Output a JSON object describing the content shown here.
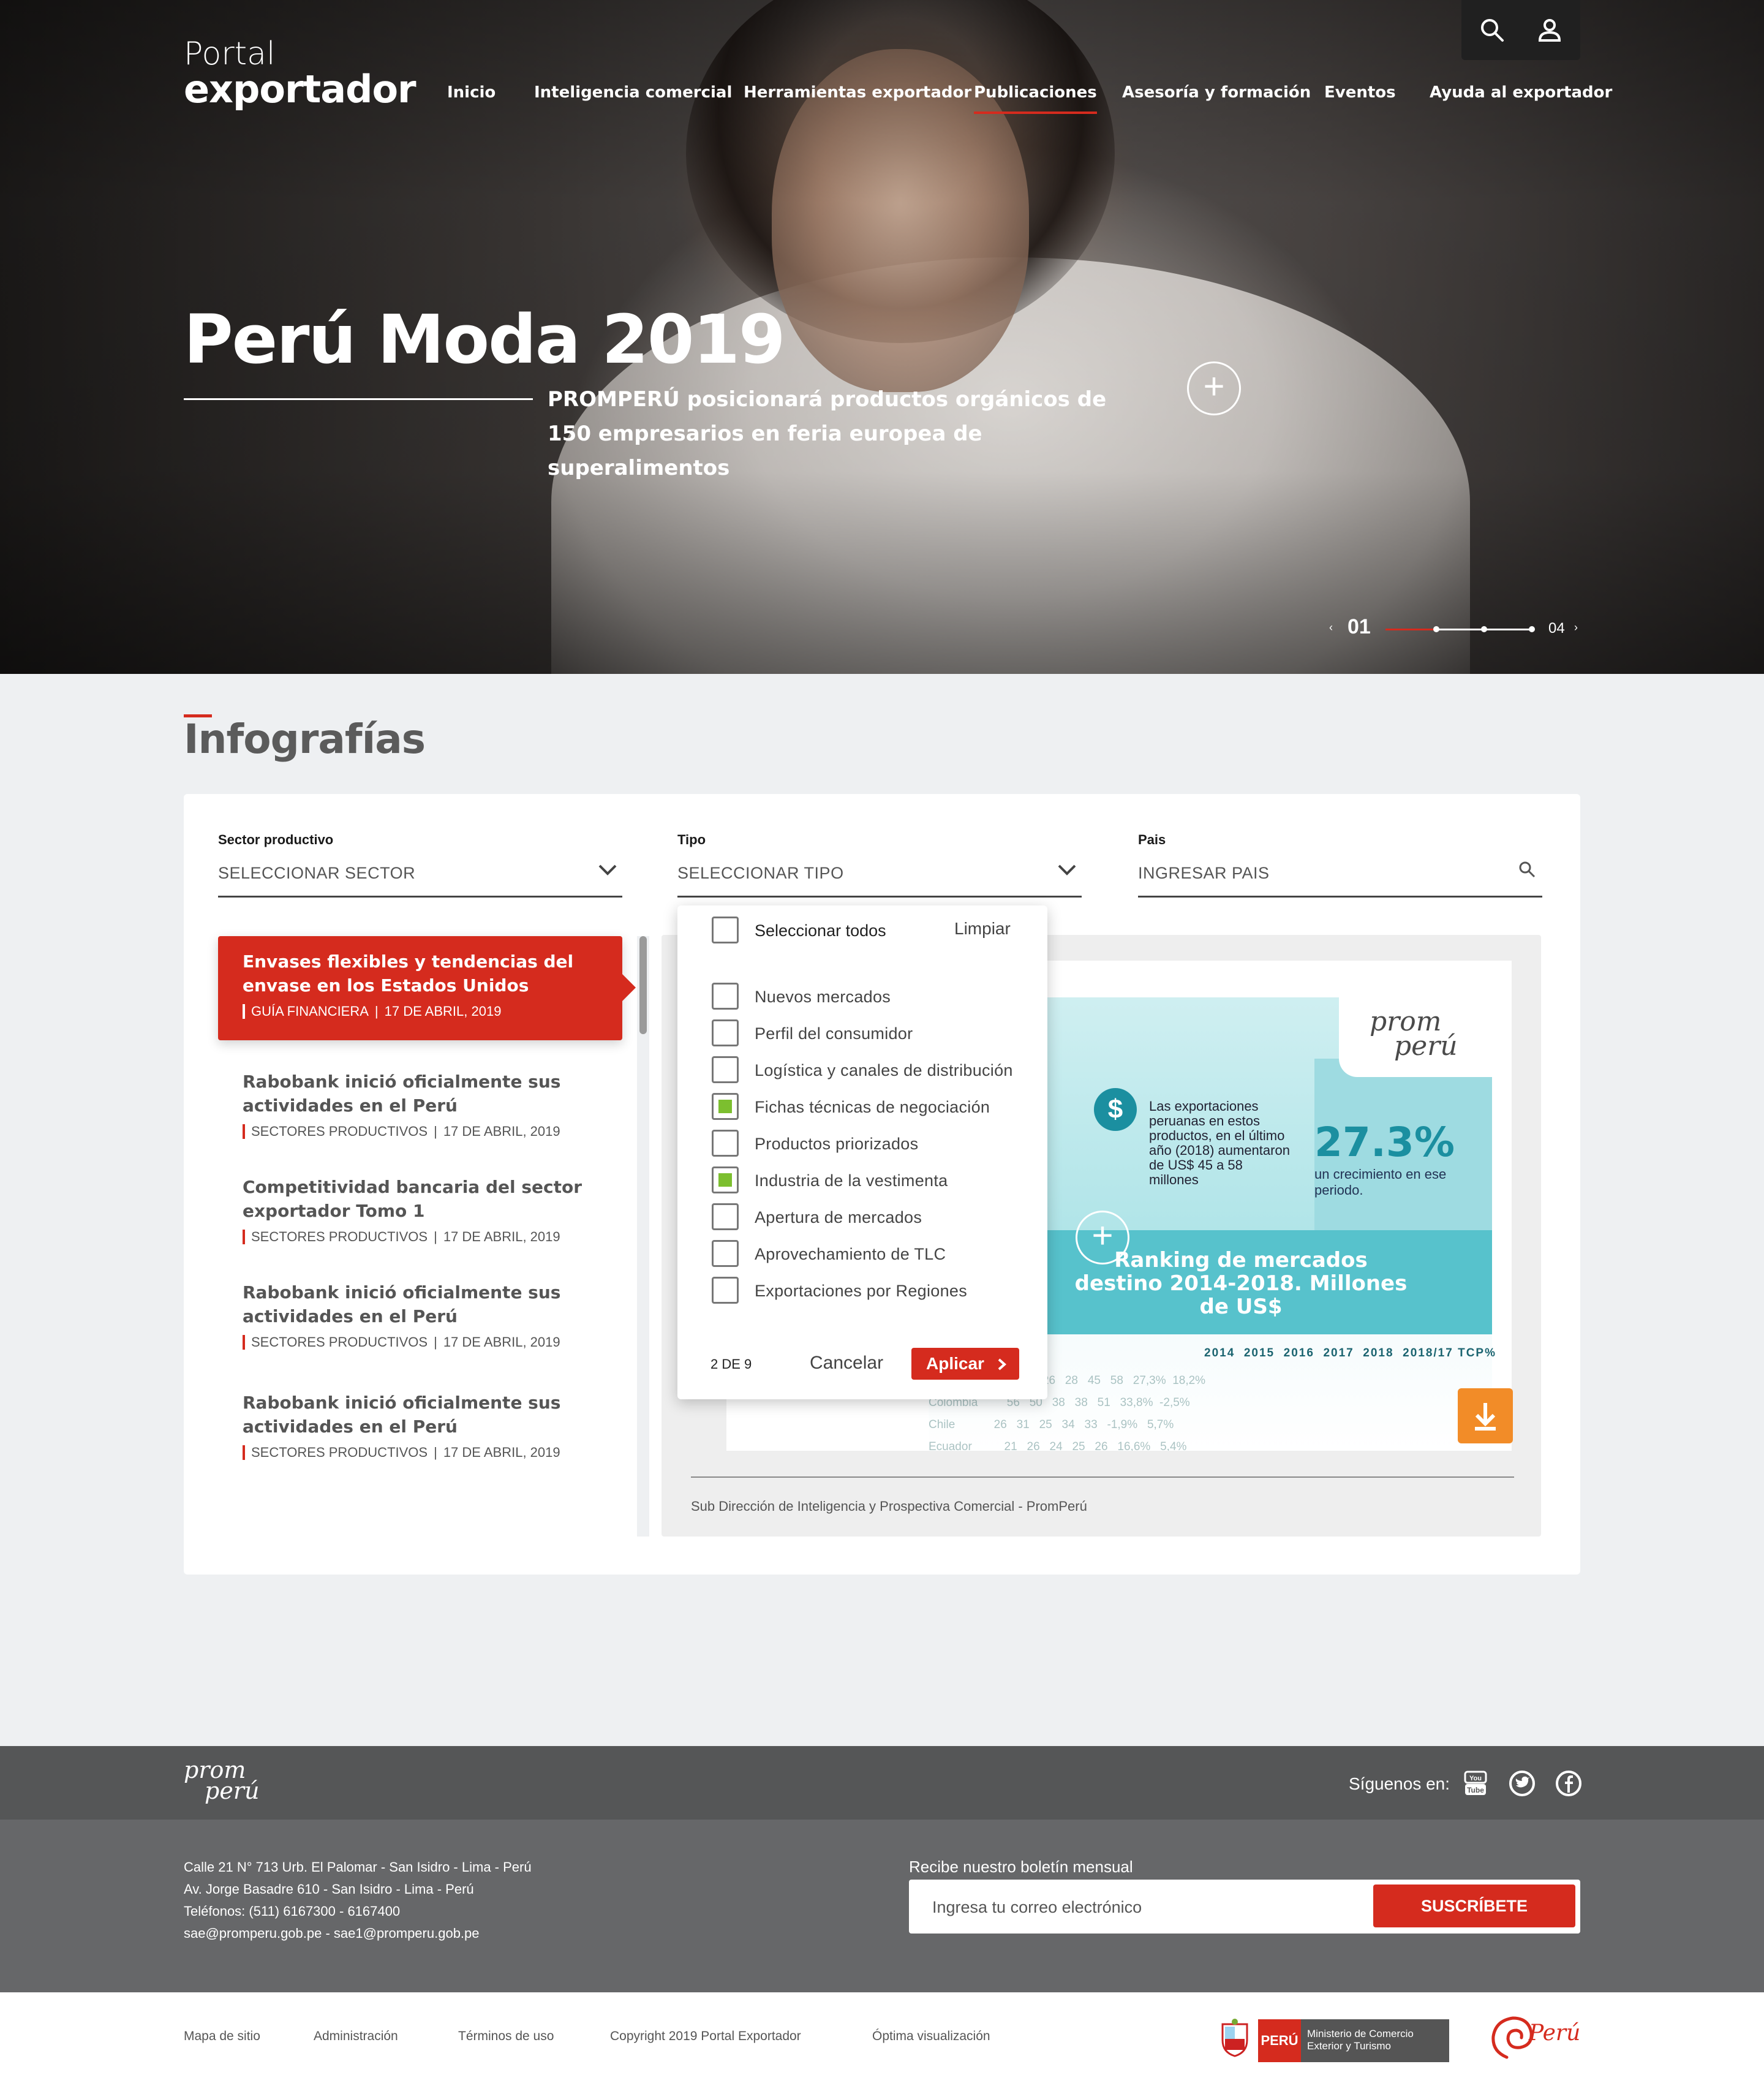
{
  "brand": {
    "line1": "Portal",
    "line2": "exportador"
  },
  "nav": [
    {
      "label": "Inicio",
      "active": false
    },
    {
      "label": "Inteligencia comercial",
      "active": false
    },
    {
      "label": "Herramientas exportador",
      "active": false
    },
    {
      "label": "Publicaciones",
      "active": true
    },
    {
      "label": "Asesoría y formación",
      "active": false
    },
    {
      "label": "Eventos",
      "active": false
    },
    {
      "label": "Ayuda al exportador",
      "active": false
    }
  ],
  "tools": {
    "search_icon": "search-icon",
    "user_icon": "user-icon"
  },
  "hero": {
    "title": "Perú Moda 2019",
    "subtitle": "PROMPERÚ posicionará productos orgánicos de 150 empresarios en feria europea de superalimentos",
    "plus": "+",
    "pager": {
      "current": "01",
      "total": "04",
      "prev": "‹",
      "next": "›",
      "progress": 0.33
    }
  },
  "section": {
    "title": "Infografías"
  },
  "filters": {
    "sector": {
      "label": "Sector productivo",
      "value": "SELECCIONAR SECTOR"
    },
    "tipo": {
      "label": "Tipo",
      "value": "SELECCIONAR TIPO"
    },
    "pais": {
      "label": "Pais",
      "placeholder": "INGRESAR PAIS"
    }
  },
  "list": [
    {
      "title": "Envases flexibles y tendencias del envase en los Estados Unidos",
      "category": "GUÍA FINANCIERA",
      "date": "17 DE ABRIL, 2019",
      "active": true
    },
    {
      "title": "Rabobank inició oficialmente sus actividades en el Perú",
      "category": "SECTORES PRODUCTIVOS",
      "date": "17 DE ABRIL, 2019",
      "active": false
    },
    {
      "title": "Competitividad bancaria del sector exportador Tomo 1",
      "category": "SECTORES PRODUCTIVOS",
      "date": "17 DE ABRIL, 2019",
      "active": false
    },
    {
      "title": "Rabobank inició oficialmente sus actividades en el Perú",
      "category": "SECTORES PRODUCTIVOS",
      "date": "17 DE ABRIL, 2019",
      "active": false
    },
    {
      "title": "Rabobank inició oficialmente sus actividades en el Perú",
      "category": "SECTORES PRODUCTIVOS",
      "date": "17 DE ABRIL, 2019",
      "active": false
    }
  ],
  "list_separator": "|",
  "dropdown": {
    "select_all": "Seleccionar todos",
    "clear": "Limpiar",
    "options": [
      {
        "label": "Nuevos mercados",
        "checked": false
      },
      {
        "label": "Perfil del consumidor",
        "checked": false
      },
      {
        "label": "Logística y canales de distribución",
        "checked": false
      },
      {
        "label": "Fichas técnicas de negociación",
        "checked": true
      },
      {
        "label": "Productos priorizados",
        "checked": false
      },
      {
        "label": "Industria de la vestimenta",
        "checked": true
      },
      {
        "label": "Apertura de mercados",
        "checked": false
      },
      {
        "label": "Aprovechamiento de TLC",
        "checked": false
      },
      {
        "label": "Exportaciones por Regiones",
        "checked": false
      }
    ],
    "count": "2 DE 9",
    "cancel": "Cancelar",
    "apply": "Aplicar"
  },
  "preview": {
    "infographic": {
      "logo_line1": "prom",
      "logo_line2": "perú",
      "dollar": "$",
      "exports_text": "Las exportaciones peruanas en estos productos, en el último año (2018) aumentaron de US$ 45 a 58 millones",
      "growth": "27.3%",
      "growth_text": "un crecimiento en ese periodo.",
      "ranking": "Ranking de mercados destino 2014-2018. Millones de US$",
      "years": "2014  2015  2016  2017  2018  2018/17 TCP%",
      "rows": "Estados Unidos   30   26   28   45   58   27,3%  18,2%\nColombia         56   50   38   38   51   33,8%  -2,5%\nChile            26   31   25   34   33   -1,9%   5,7%\nEcuador          21   26   24   25   26   16,6%   5,4%"
    },
    "caption": "Sub Dirección de Inteligencia y Prospectiva Comercial - PromPerú"
  },
  "footer": {
    "logo_line1": "prom",
    "logo_line2": "perú",
    "follow": "Síguenos en:",
    "social": [
      "youtube-icon",
      "twitter-icon",
      "facebook-icon"
    ],
    "address": [
      "Calle 21 N° 713 Urb. El Palomar - San Isidro - Lima - Perú",
      "Av. Jorge Basadre 610 - San Isidro - Lima - Perú",
      "Teléfonos: (511) 6167300 - 6167400",
      "sae@promperu.gob.pe - sae1@promperu.gob.pe"
    ],
    "newsletter": {
      "label": "Recibe nuestro boletín mensual",
      "placeholder": "Ingresa tu correo electrónico",
      "button": "SUSCRÍBETE"
    },
    "links": [
      "Mapa de sitio",
      "Administración",
      "Términos de uso",
      "Copyright 2019 Portal Exportador",
      "Óptima visualización"
    ],
    "ministry": {
      "peru": "PERÚ",
      "name1": "Ministerio de Comercio",
      "name2": "Exterior y Turismo"
    },
    "marca_peru": "Perú"
  },
  "colors": {
    "accent": "#d52b1e",
    "check": "#7cbf2f",
    "download": "#f28c28",
    "footer_dark": "#555657",
    "footer_mid": "#666769"
  }
}
